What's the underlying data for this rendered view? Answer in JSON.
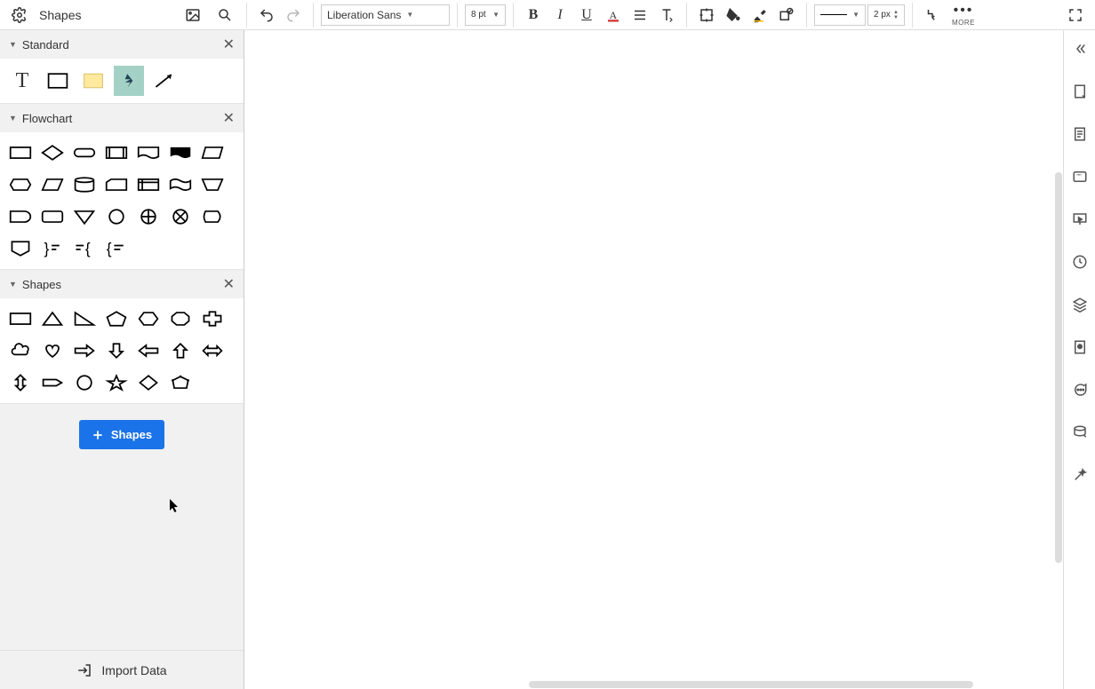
{
  "toolbar": {
    "title": "Shapes",
    "font_family": "Liberation Sans",
    "font_size": "8 pt",
    "line_width": "2 px",
    "more_label": "MORE"
  },
  "sidebar": {
    "sections": [
      {
        "title": "Standard"
      },
      {
        "title": "Flowchart"
      },
      {
        "title": "Shapes"
      }
    ],
    "add_button_label": "Shapes",
    "import_label": "Import Data"
  },
  "shape_names": {
    "standard": [
      "text",
      "rectangle",
      "note",
      "action",
      "arrow"
    ],
    "flowchart": [
      "process",
      "decision",
      "terminator",
      "predefined",
      "document",
      "document-inverted",
      "parallelogram",
      "hexagon",
      "skew",
      "database",
      "card",
      "internal-storage",
      "tape",
      "manual-operation",
      "half-round",
      "rounded-rect",
      "triangle-down",
      "circle",
      "crossed-circle",
      "x-circle",
      "display",
      "offpage",
      "brace-right",
      "brace-left",
      "brace-open"
    ],
    "shapes": [
      "rectangle",
      "triangle",
      "right-triangle",
      "pentagon",
      "hexagon",
      "octagon",
      "cross",
      "cloud",
      "heart",
      "arrow-right",
      "arrow-down",
      "arrow-left",
      "arrow-up",
      "arrow-bi-h",
      "arrow-bi-v",
      "label",
      "circle",
      "star",
      "diamond",
      "polygon"
    ]
  }
}
